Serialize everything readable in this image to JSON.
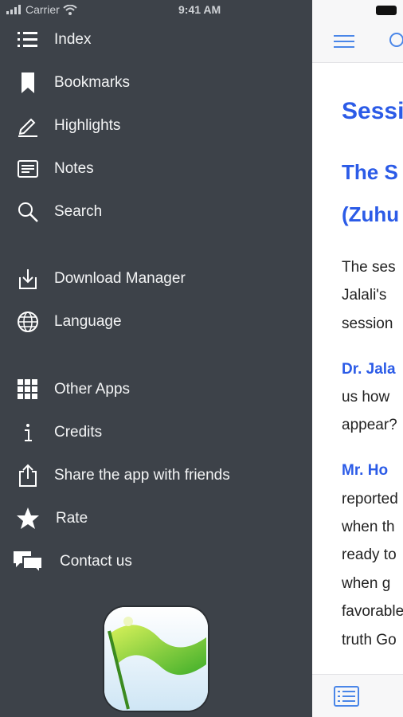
{
  "status": {
    "carrier": "Carrier",
    "time": "9:41 AM"
  },
  "menu": {
    "items": [
      {
        "label": "Index",
        "icon": "list-icon"
      },
      {
        "label": "Bookmarks",
        "icon": "bookmark-icon"
      },
      {
        "label": "Highlights",
        "icon": "pencil-icon"
      },
      {
        "label": "Notes",
        "icon": "notes-icon"
      },
      {
        "label": "Search",
        "icon": "search-icon"
      },
      {
        "label": "Download Manager",
        "icon": "download-icon"
      },
      {
        "label": "Language",
        "icon": "globe-icon"
      },
      {
        "label": "Other Apps",
        "icon": "grid-icon"
      },
      {
        "label": "Credits",
        "icon": "info-icon"
      },
      {
        "label": "Share the app with friends",
        "icon": "share-icon"
      },
      {
        "label": "Rate",
        "icon": "star-icon"
      },
      {
        "label": "Contact us",
        "icon": "chat-icon"
      }
    ]
  },
  "content": {
    "lines": [
      "Sessi",
      "The S",
      "(Zuhu",
      "The ses",
      "Jalali's",
      "session",
      "Dr. Jala",
      "us how",
      "appear?",
      "Mr. Ho",
      "reported",
      "when th",
      "ready to",
      "when g",
      "favorable",
      "truth Go"
    ]
  },
  "colors": {
    "drawer_bg": "#3d4249",
    "accent": "#2b5be7"
  }
}
